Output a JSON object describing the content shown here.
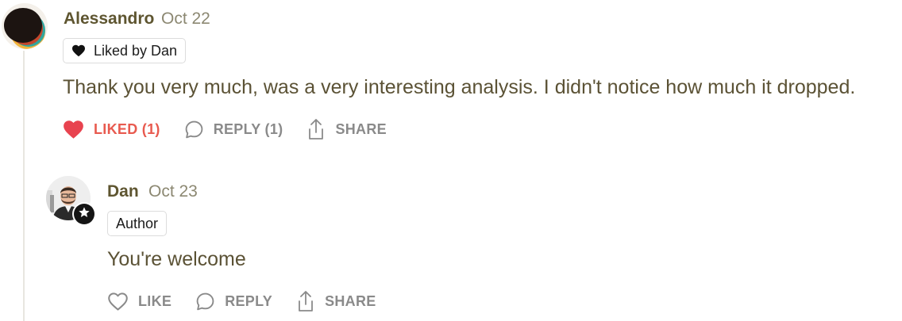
{
  "comment": {
    "author": "Alessandro",
    "date": "Oct 22",
    "badge": "Liked by Dan",
    "text": "Thank you very much, was a very interesting analysis. I didn't notice how much it dropped.",
    "actions": {
      "like": "LIKED (1)",
      "reply": "REPLY (1)",
      "share": "SHARE"
    },
    "like_color": "#e85a4f"
  },
  "reply": {
    "author": "Dan",
    "date": "Oct 23",
    "badge": "Author",
    "text": "You're welcome",
    "actions": {
      "like": "LIKE",
      "reply": "REPLY",
      "share": "SHARE"
    }
  },
  "colors": {
    "name": "#5e5530",
    "date": "#8c8872",
    "text": "#5b5235",
    "action": "#8a8a8a",
    "thread_line": "#e8e6e0"
  },
  "icons": [
    "heart-icon",
    "comment-bubble-icon",
    "share-icon",
    "star-icon"
  ]
}
